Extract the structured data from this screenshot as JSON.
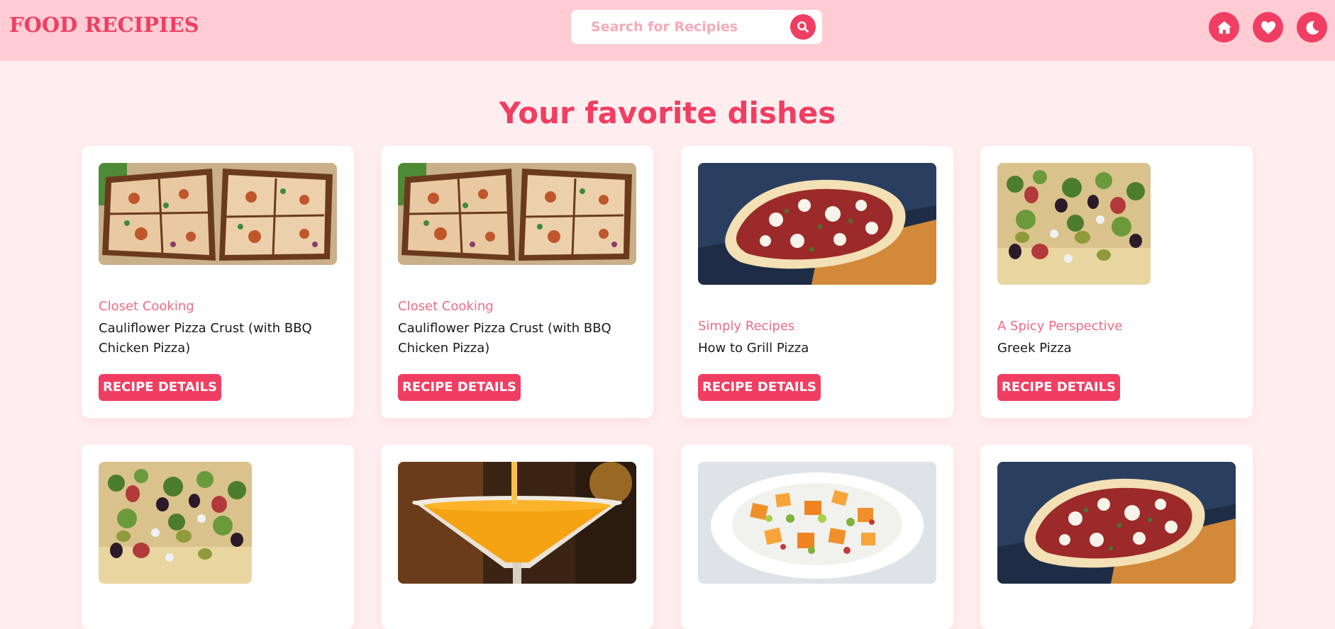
{
  "header": {
    "logo": "FOOD RECIPIES",
    "search": {
      "placeholder": "Search for Recipies",
      "value": ""
    },
    "nav_icons": [
      "home-icon",
      "heart-icon",
      "moon-icon"
    ]
  },
  "main": {
    "title": "Your favorite dishes",
    "button_label": "RECIPE DETAILS",
    "recipes": [
      {
        "publisher": "Closet Cooking",
        "title": "Cauliflower Pizza Crust (with BBQ Chicken Pizza)",
        "image": "bbq-chicken-pizza"
      },
      {
        "publisher": "Closet Cooking",
        "title": "Cauliflower Pizza Crust (with BBQ Chicken Pizza)",
        "image": "bbq-chicken-pizza"
      },
      {
        "publisher": "Simply Recipes",
        "title": "How to Grill Pizza",
        "image": "grilled-pizza"
      },
      {
        "publisher": "A Spicy Perspective",
        "title": "Greek Pizza",
        "image": "greek-pizza"
      },
      {
        "publisher": "",
        "title": "",
        "image": "greek-pizza"
      },
      {
        "publisher": "",
        "title": "",
        "image": "mango-cocktail"
      },
      {
        "publisher": "",
        "title": "",
        "image": "mango-salsa"
      },
      {
        "publisher": "",
        "title": "",
        "image": "grilled-pizza"
      }
    ]
  },
  "colors": {
    "accent": "#f03e62",
    "header_bg": "#ffccd4",
    "page_bg": "#ffeef0",
    "publisher_text": "#f06b86"
  }
}
